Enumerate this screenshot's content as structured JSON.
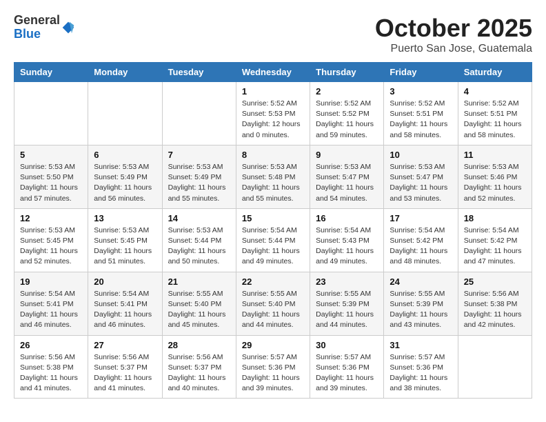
{
  "header": {
    "logo": {
      "general": "General",
      "blue": "Blue"
    },
    "month": "October 2025",
    "location": "Puerto San Jose, Guatemala"
  },
  "weekdays": [
    "Sunday",
    "Monday",
    "Tuesday",
    "Wednesday",
    "Thursday",
    "Friday",
    "Saturday"
  ],
  "weeks": [
    [
      {
        "day": "",
        "info": ""
      },
      {
        "day": "",
        "info": ""
      },
      {
        "day": "",
        "info": ""
      },
      {
        "day": "1",
        "info": "Sunrise: 5:52 AM\nSunset: 5:53 PM\nDaylight: 12 hours\nand 0 minutes."
      },
      {
        "day": "2",
        "info": "Sunrise: 5:52 AM\nSunset: 5:52 PM\nDaylight: 11 hours\nand 59 minutes."
      },
      {
        "day": "3",
        "info": "Sunrise: 5:52 AM\nSunset: 5:51 PM\nDaylight: 11 hours\nand 58 minutes."
      },
      {
        "day": "4",
        "info": "Sunrise: 5:52 AM\nSunset: 5:51 PM\nDaylight: 11 hours\nand 58 minutes."
      }
    ],
    [
      {
        "day": "5",
        "info": "Sunrise: 5:53 AM\nSunset: 5:50 PM\nDaylight: 11 hours\nand 57 minutes."
      },
      {
        "day": "6",
        "info": "Sunrise: 5:53 AM\nSunset: 5:49 PM\nDaylight: 11 hours\nand 56 minutes."
      },
      {
        "day": "7",
        "info": "Sunrise: 5:53 AM\nSunset: 5:49 PM\nDaylight: 11 hours\nand 55 minutes."
      },
      {
        "day": "8",
        "info": "Sunrise: 5:53 AM\nSunset: 5:48 PM\nDaylight: 11 hours\nand 55 minutes."
      },
      {
        "day": "9",
        "info": "Sunrise: 5:53 AM\nSunset: 5:47 PM\nDaylight: 11 hours\nand 54 minutes."
      },
      {
        "day": "10",
        "info": "Sunrise: 5:53 AM\nSunset: 5:47 PM\nDaylight: 11 hours\nand 53 minutes."
      },
      {
        "day": "11",
        "info": "Sunrise: 5:53 AM\nSunset: 5:46 PM\nDaylight: 11 hours\nand 52 minutes."
      }
    ],
    [
      {
        "day": "12",
        "info": "Sunrise: 5:53 AM\nSunset: 5:45 PM\nDaylight: 11 hours\nand 52 minutes."
      },
      {
        "day": "13",
        "info": "Sunrise: 5:53 AM\nSunset: 5:45 PM\nDaylight: 11 hours\nand 51 minutes."
      },
      {
        "day": "14",
        "info": "Sunrise: 5:53 AM\nSunset: 5:44 PM\nDaylight: 11 hours\nand 50 minutes."
      },
      {
        "day": "15",
        "info": "Sunrise: 5:54 AM\nSunset: 5:44 PM\nDaylight: 11 hours\nand 49 minutes."
      },
      {
        "day": "16",
        "info": "Sunrise: 5:54 AM\nSunset: 5:43 PM\nDaylight: 11 hours\nand 49 minutes."
      },
      {
        "day": "17",
        "info": "Sunrise: 5:54 AM\nSunset: 5:42 PM\nDaylight: 11 hours\nand 48 minutes."
      },
      {
        "day": "18",
        "info": "Sunrise: 5:54 AM\nSunset: 5:42 PM\nDaylight: 11 hours\nand 47 minutes."
      }
    ],
    [
      {
        "day": "19",
        "info": "Sunrise: 5:54 AM\nSunset: 5:41 PM\nDaylight: 11 hours\nand 46 minutes."
      },
      {
        "day": "20",
        "info": "Sunrise: 5:54 AM\nSunset: 5:41 PM\nDaylight: 11 hours\nand 46 minutes."
      },
      {
        "day": "21",
        "info": "Sunrise: 5:55 AM\nSunset: 5:40 PM\nDaylight: 11 hours\nand 45 minutes."
      },
      {
        "day": "22",
        "info": "Sunrise: 5:55 AM\nSunset: 5:40 PM\nDaylight: 11 hours\nand 44 minutes."
      },
      {
        "day": "23",
        "info": "Sunrise: 5:55 AM\nSunset: 5:39 PM\nDaylight: 11 hours\nand 44 minutes."
      },
      {
        "day": "24",
        "info": "Sunrise: 5:55 AM\nSunset: 5:39 PM\nDaylight: 11 hours\nand 43 minutes."
      },
      {
        "day": "25",
        "info": "Sunrise: 5:56 AM\nSunset: 5:38 PM\nDaylight: 11 hours\nand 42 minutes."
      }
    ],
    [
      {
        "day": "26",
        "info": "Sunrise: 5:56 AM\nSunset: 5:38 PM\nDaylight: 11 hours\nand 41 minutes."
      },
      {
        "day": "27",
        "info": "Sunrise: 5:56 AM\nSunset: 5:37 PM\nDaylight: 11 hours\nand 41 minutes."
      },
      {
        "day": "28",
        "info": "Sunrise: 5:56 AM\nSunset: 5:37 PM\nDaylight: 11 hours\nand 40 minutes."
      },
      {
        "day": "29",
        "info": "Sunrise: 5:57 AM\nSunset: 5:36 PM\nDaylight: 11 hours\nand 39 minutes."
      },
      {
        "day": "30",
        "info": "Sunrise: 5:57 AM\nSunset: 5:36 PM\nDaylight: 11 hours\nand 39 minutes."
      },
      {
        "day": "31",
        "info": "Sunrise: 5:57 AM\nSunset: 5:36 PM\nDaylight: 11 hours\nand 38 minutes."
      },
      {
        "day": "",
        "info": ""
      }
    ]
  ]
}
